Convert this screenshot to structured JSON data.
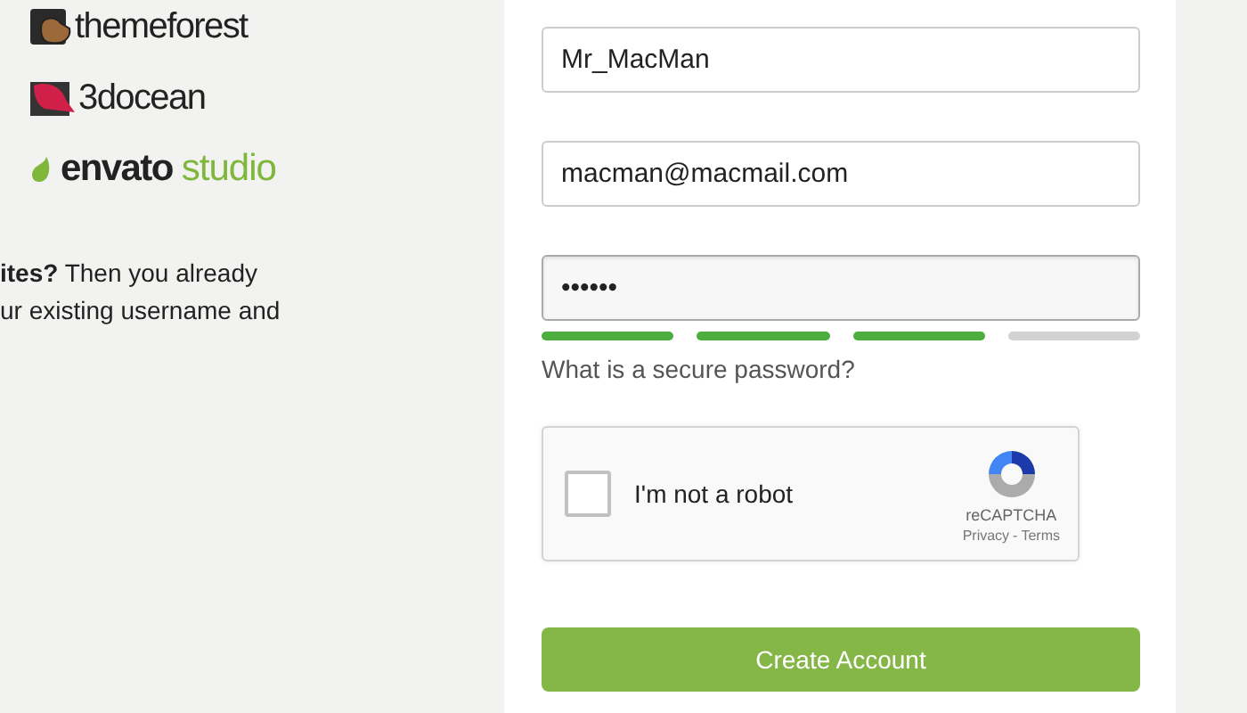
{
  "brands": [
    {
      "kind": "themeforest",
      "name": "themeforest"
    },
    {
      "kind": "ocean",
      "name": "3docean"
    },
    {
      "kind": "envato",
      "name": "envato",
      "suffix": "studio"
    }
  ],
  "intro_lines": [
    "**ites?** Then you already",
    "ur existing username and"
  ],
  "fields": [
    {
      "value": "Mr_MacMan",
      "focused": false
    },
    {
      "value": "macman@macmail.com",
      "focused": false
    },
    {
      "value": "••••••",
      "focused": true
    }
  ],
  "strength": [
    {
      "on": true
    },
    {
      "on": true
    },
    {
      "on": true
    },
    {
      "on": false
    }
  ],
  "help_link": "What is a secure password?",
  "captcha": {
    "label": "I'm not a robot",
    "checked": false,
    "brand": "reCAPTCHA",
    "privacy": "Privacy",
    "separator": "-",
    "terms": "Terms"
  },
  "submit": "Create Account"
}
